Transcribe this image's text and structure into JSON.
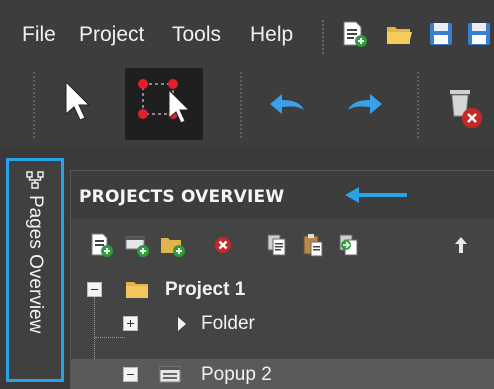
{
  "menu": {
    "items": [
      "File",
      "Project",
      "Tools",
      "Help"
    ]
  },
  "toolbar": {
    "icons": [
      "new-page-icon",
      "open-folder-icon",
      "save-icon",
      "save-all-icon"
    ],
    "tools": [
      "select-pointer-icon",
      "transform-select-icon",
      "undo-icon",
      "redo-icon",
      "delete-icon"
    ]
  },
  "pages_tab": {
    "label": "Pages Overview"
  },
  "projects_panel": {
    "title": "PROJECTS OVERVIEW",
    "tools": [
      "add-page-icon",
      "add-popup-icon",
      "add-folder-icon",
      "delete-icon",
      "copy-icon",
      "paste-icon",
      "duplicate-icon",
      "move-up-icon"
    ],
    "tree": [
      {
        "label": "Project 1",
        "type": "project",
        "expanded": true
      },
      {
        "label": "Folder",
        "type": "folder",
        "expanded": false
      },
      {
        "label": "Popup 2",
        "type": "popup",
        "selected": true
      }
    ]
  },
  "colors": {
    "accent": "#2aa2e6",
    "background": "#3b3b3b"
  }
}
